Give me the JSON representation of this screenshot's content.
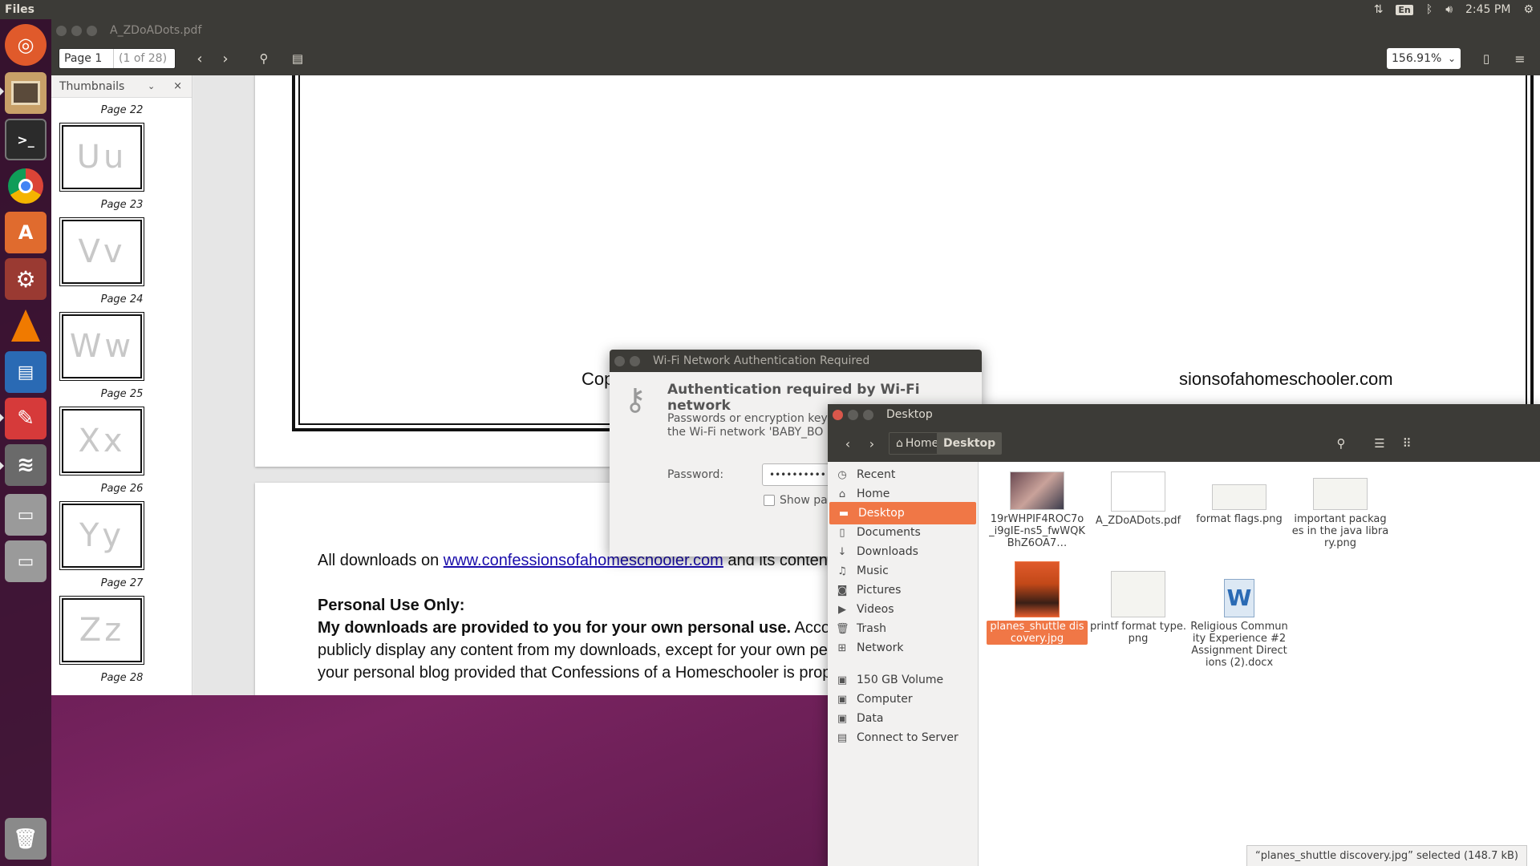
{
  "top_panel": {
    "app_name": "Files",
    "keyboard_layout": "En",
    "time": "2:45 PM"
  },
  "launcher": {
    "items": [
      {
        "name": "ubuntu-dash",
        "icon": "ubuntu-logo-icon",
        "color": "#e05a2b"
      },
      {
        "name": "files",
        "icon": "file-cabinet-icon",
        "color": "#c8a068"
      },
      {
        "name": "terminal",
        "icon": "terminal-icon",
        "color": "#2b2b2b"
      },
      {
        "name": "chrome",
        "icon": "chrome-icon",
        "color": "#4285f4"
      },
      {
        "name": "software-center",
        "icon": "shopping-bag-icon",
        "color": "#e06b2e"
      },
      {
        "name": "system-settings",
        "icon": "wrench-gear-icon",
        "color": "#c23a2a"
      },
      {
        "name": "vlc",
        "icon": "traffic-cone-icon",
        "color": "#f07a00"
      },
      {
        "name": "libreoffice-writer",
        "icon": "document-icon",
        "color": "#2a6ab4"
      },
      {
        "name": "document-viewer",
        "icon": "pdf-viewer-icon",
        "color": "#d63a3a"
      },
      {
        "name": "network",
        "icon": "wifi-icon",
        "color": "#777777"
      },
      {
        "name": "disk-1",
        "icon": "drive-icon",
        "color": "#9a9a9a"
      },
      {
        "name": "disk-2",
        "icon": "drive-icon",
        "color": "#9a9a9a"
      },
      {
        "name": "trash",
        "icon": "trash-icon",
        "color": "#8a8a8a"
      }
    ]
  },
  "evince": {
    "title": "A_ZDoADots.pdf",
    "page_entry": "Page 1",
    "page_count": "(1 of 28)",
    "zoom": "156.91%",
    "sidebar_header": "Thumbnails",
    "thumbnails": [
      {
        "label": "Page 22",
        "letters": ""
      },
      {
        "label": "Page 23",
        "letters": "Uu"
      },
      {
        "label": "Page 24",
        "letters": "Vv"
      },
      {
        "label": "Page 25",
        "letters": "Ww"
      },
      {
        "label": "Page 26",
        "letters": "Xx"
      },
      {
        "label": "Page 27",
        "letters": "Yy"
      },
      {
        "label": "Page 28",
        "letters": "Zz"
      }
    ],
    "copyright_left": "Copyright",
    "copyright_right": "sionsofahomeschooler.com",
    "downloads_prefix": "All downloads on ",
    "downloads_link": "www.confessionsofahomeschooler.com",
    "downloads_suffix": " and its contents ar",
    "personal_use_heading": "Personal Use Only:",
    "personal_use_bold": "My downloads are provided to you for your own personal use.",
    "personal_use_rest": " Accordingly, y",
    "line_3": "publicly display any content from my downloads, except for your own person",
    "line_4": "your personal blog provided that Confessions of a Homeschooler is properly c"
  },
  "wifi_dialog": {
    "title": "Wi-Fi Network Authentication Required",
    "heading": "Authentication required by Wi-Fi network",
    "description": "Passwords or encryption keys\nthe Wi-Fi network 'BABY_BO",
    "password_label": "Password:",
    "password_value": "••••••••••",
    "show_password": "Show pa"
  },
  "files": {
    "title": "Desktop",
    "breadcrumb": [
      "Home",
      "Desktop"
    ],
    "sidebar": [
      {
        "label": "Recent",
        "icon": "clock-icon"
      },
      {
        "label": "Home",
        "icon": "home-icon"
      },
      {
        "label": "Desktop",
        "icon": "folder-icon",
        "selected": true
      },
      {
        "label": "Documents",
        "icon": "document-icon"
      },
      {
        "label": "Downloads",
        "icon": "download-icon"
      },
      {
        "label": "Music",
        "icon": "music-icon"
      },
      {
        "label": "Pictures",
        "icon": "camera-icon"
      },
      {
        "label": "Videos",
        "icon": "video-icon"
      },
      {
        "label": "Trash",
        "icon": "trash-icon"
      },
      {
        "label": "Network",
        "icon": "network-icon"
      },
      {
        "label": "150 GB Volume",
        "icon": "drive-icon"
      },
      {
        "label": "Computer",
        "icon": "drive-icon"
      },
      {
        "label": "Data",
        "icon": "drive-icon"
      },
      {
        "label": "Connect to Server",
        "icon": "server-icon"
      }
    ],
    "files": [
      {
        "name": "19rWHPIF4ROC7o_i9gIE-ns5_fwWQKBhZ6OA7…",
        "kind": "photo"
      },
      {
        "name": "A_ZDoADots.pdf",
        "kind": "pdf"
      },
      {
        "name": "format flags.png",
        "kind": "image"
      },
      {
        "name": "important packages in the java library.png",
        "kind": "image"
      },
      {
        "name": "planes_shuttle discovery.jpg",
        "kind": "photo-selected",
        "selected": true
      },
      {
        "name": "printf format type.png",
        "kind": "image"
      },
      {
        "name": "Religious Community Experience #2 Assignment Directions  (2).docx",
        "kind": "docx"
      }
    ],
    "status": "“planes_shuttle discovery.jpg” selected  (148.7 kB)"
  },
  "colors": {
    "accent": "#f07746",
    "panel": "#3c3b37",
    "close_button": "#d9574b"
  }
}
